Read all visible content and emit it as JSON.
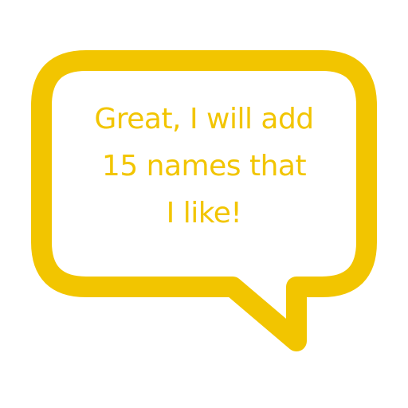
{
  "colors": {
    "accent": "#F2C500",
    "background": "#FFFFFF"
  },
  "icon": "speech-bubble-icon",
  "message": {
    "lines": [
      "Great, I will add",
      "15 names that",
      "I like!"
    ]
  }
}
